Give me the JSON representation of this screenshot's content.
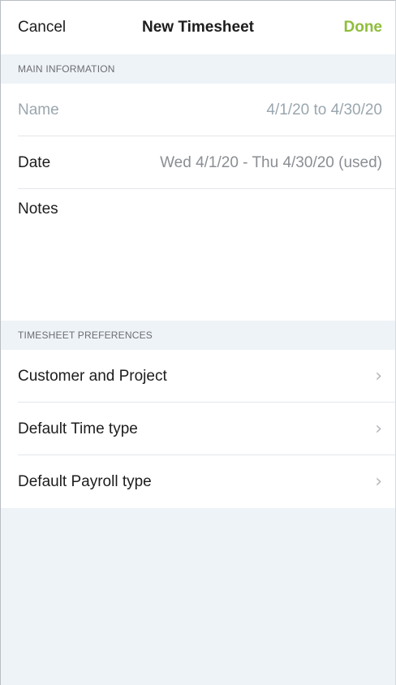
{
  "navbar": {
    "cancel_label": "Cancel",
    "title": "New Timesheet",
    "done_label": "Done"
  },
  "main_information": {
    "header": "MAIN INFORMATION",
    "name_label": "Name",
    "name_value": "4/1/20 to 4/30/20",
    "date_label": "Date",
    "date_value": "Wed 4/1/20 - Thu 4/30/20 (used)",
    "notes_label": "Notes"
  },
  "timesheet_preferences": {
    "header": "TIMESHEET PREFERENCES",
    "items": [
      {
        "label": "Customer and Project",
        "icon": "chevron-right-icon"
      },
      {
        "label": "Default Time type",
        "icon": "chevron-right-icon"
      },
      {
        "label": "Default Payroll type",
        "icon": "chevron-right-icon"
      }
    ]
  },
  "colors": {
    "accent": "#8fbe3b",
    "background": "#eef3f7",
    "placeholder": "#9aa6ae"
  }
}
